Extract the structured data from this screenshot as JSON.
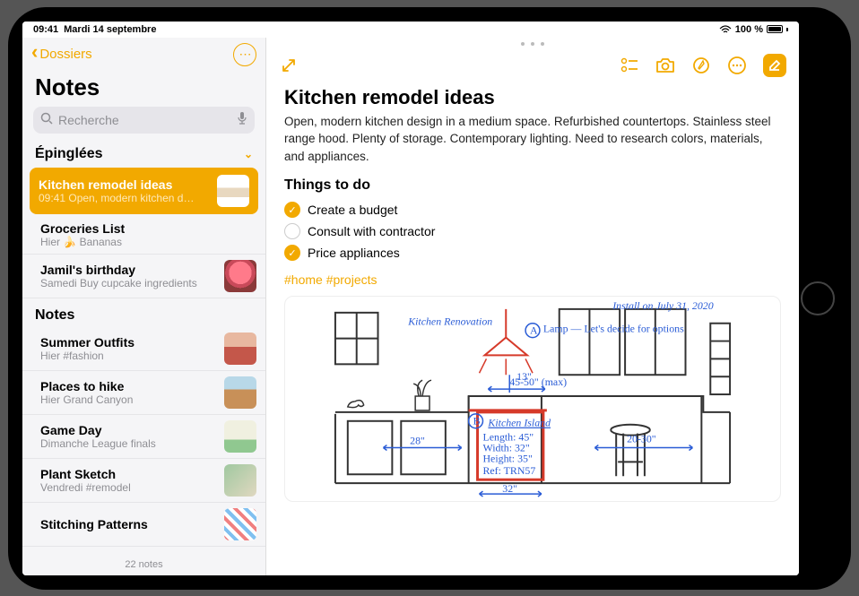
{
  "status": {
    "time": "09:41",
    "date": "Mardi 14 septembre",
    "battery_label": "100 %"
  },
  "sidebar": {
    "back_label": "Dossiers",
    "title": "Notes",
    "search_placeholder": "Recherche",
    "footer": "22 notes",
    "pinned_header": "Épinglées",
    "notes_header": "Notes",
    "pinned": [
      {
        "title": "Kitchen remodel ideas",
        "subtitle": "09:41  Open, modern kitchen d…"
      },
      {
        "title": "Groceries List",
        "subtitle": "Hier 🍌 Bananas"
      },
      {
        "title": "Jamil's birthday",
        "subtitle": "Samedi Buy cupcake ingredients"
      }
    ],
    "notes": [
      {
        "title": "Summer Outfits",
        "subtitle": "Hier #fashion"
      },
      {
        "title": "Places to hike",
        "subtitle": "Hier Grand Canyon"
      },
      {
        "title": "Game Day",
        "subtitle": "Dimanche League finals"
      },
      {
        "title": "Plant Sketch",
        "subtitle": "Vendredi #remodel"
      },
      {
        "title": "Stitching Patterns",
        "subtitle": ""
      }
    ]
  },
  "note": {
    "title": "Kitchen remodel ideas",
    "body": "Open, modern kitchen design in a medium space. Refurbished countertops. Stainless steel range hood. Plenty of storage. Contemporary lighting. Need to research colors, materials, and appliances.",
    "things_header": "Things to do",
    "checklist": [
      {
        "label": "Create a budget",
        "done": true
      },
      {
        "label": "Consult with contractor",
        "done": false
      },
      {
        "label": "Price appliances",
        "done": true
      }
    ],
    "tags": "#home #projects",
    "sketch": {
      "header": "Kitchen Renovation",
      "install": "Install on July 31, 2020",
      "lamp_note": "Lamp — Let's decide for options",
      "circle_a": "A",
      "circle_b": "B",
      "island_title": "Kitchen Island",
      "island_spec_length": "Length: 45\"",
      "island_spec_width": "Width: 32\"",
      "island_spec_height": "Height: 35\"",
      "island_ref": "Ref: TRN57",
      "dim_45_50": "45-50\" (max)",
      "dim_28": "28\"",
      "dim_20_30": "20-30\"",
      "dim_32": "32\"",
      "dim_13": "13\""
    }
  }
}
